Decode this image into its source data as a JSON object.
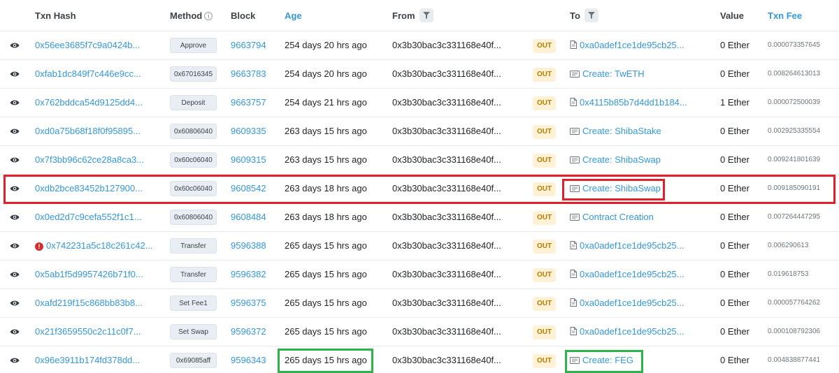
{
  "headers": {
    "txn_hash": "Txn Hash",
    "method": "Method",
    "block": "Block",
    "age": "Age",
    "from": "From",
    "to": "To",
    "value": "Value",
    "txn_fee": "Txn Fee"
  },
  "colors": {
    "link": "#3498db",
    "out_badge_bg": "#fff1d6",
    "out_badge_text": "#b47d00",
    "highlight_red": "#e0212c",
    "highlight_green": "#2db34a"
  },
  "rows": [
    {
      "hash": "0x56ee3685f7c9a0424b...",
      "method": "Approve",
      "block": "9663794",
      "age": "254 days 20 hrs ago",
      "from": "0x3b30bac3c331168e40f...",
      "direction": "OUT",
      "to": "0xa0adef1ce1de95cb25...",
      "to_icon": "file-icon",
      "value": "0 Ether",
      "fee": "0.000073357645",
      "error": false
    },
    {
      "hash": "0xfab1dc849f7c446e9cc...",
      "method": "0x67016345",
      "block": "9663783",
      "age": "254 days 20 hrs ago",
      "from": "0x3b30bac3c331168e40f...",
      "direction": "OUT",
      "to": "Create: TwETH",
      "to_icon": "contract-icon",
      "value": "0 Ether",
      "fee": "0.008264613013",
      "error": false
    },
    {
      "hash": "0x762bddca54d9125dd4...",
      "method": "Deposit",
      "block": "9663757",
      "age": "254 days 21 hrs ago",
      "from": "0x3b30bac3c331168e40f...",
      "direction": "OUT",
      "to": "0x4115b85b7d4dd1b184...",
      "to_icon": "file-icon",
      "value": "1 Ether",
      "fee": "0.000072500039",
      "error": false
    },
    {
      "hash": "0xd0a75b68f18f0f95895...",
      "method": "0x60806040",
      "block": "9609335",
      "age": "263 days 15 hrs ago",
      "from": "0x3b30bac3c331168e40f...",
      "direction": "OUT",
      "to": "Create: ShibaStake",
      "to_icon": "contract-icon",
      "value": "0 Ether",
      "fee": "0.002925335554",
      "error": false
    },
    {
      "hash": "0x7f3bb96c62ce28a8ca3...",
      "method": "0x60c06040",
      "block": "9609315",
      "age": "263 days 15 hrs ago",
      "from": "0x3b30bac3c331168e40f...",
      "direction": "OUT",
      "to": "Create: ShibaSwap",
      "to_icon": "contract-icon",
      "value": "0 Ether",
      "fee": "0.009241801639",
      "error": false
    },
    {
      "hash": "0xdb2bce83452b127900...",
      "method": "0x60c06040",
      "block": "9608542",
      "age": "263 days 18 hrs ago",
      "from": "0x3b30bac3c331168e40f...",
      "direction": "OUT",
      "to": "Create: ShibaSwap",
      "to_icon": "contract-icon",
      "value": "0 Ether",
      "fee": "0.009185090191",
      "error": false
    },
    {
      "hash": "0x0ed2d7c9cefa552f1c1...",
      "method": "0x60806040",
      "block": "9608484",
      "age": "263 days 18 hrs ago",
      "from": "0x3b30bac3c331168e40f...",
      "direction": "OUT",
      "to": "Contract Creation",
      "to_icon": "contract-icon",
      "value": "0 Ether",
      "fee": "0.007264447295",
      "error": false
    },
    {
      "hash": "0x742231a5c18c261c42...",
      "method": "Transfer",
      "block": "9596388",
      "age": "265 days 15 hrs ago",
      "from": "0x3b30bac3c331168e40f...",
      "direction": "OUT",
      "to": "0xa0adef1ce1de95cb25...",
      "to_icon": "file-icon",
      "value": "0 Ether",
      "fee": "0.006290613",
      "error": true
    },
    {
      "hash": "0x5ab1f5d9957426b71f0...",
      "method": "Transfer",
      "block": "9596382",
      "age": "265 days 15 hrs ago",
      "from": "0x3b30bac3c331168e40f...",
      "direction": "OUT",
      "to": "0xa0adef1ce1de95cb25...",
      "to_icon": "file-icon",
      "value": "0 Ether",
      "fee": "0.019618753",
      "error": false
    },
    {
      "hash": "0xafd219f15c868bb83b8...",
      "method": "Set Fee1",
      "block": "9596375",
      "age": "265 days 15 hrs ago",
      "from": "0x3b30bac3c331168e40f...",
      "direction": "OUT",
      "to": "0xa0adef1ce1de95cb25...",
      "to_icon": "file-icon",
      "value": "0 Ether",
      "fee": "0.000057764262",
      "error": false
    },
    {
      "hash": "0x21f3659550c2c11c0f7...",
      "method": "Set Swap",
      "block": "9596372",
      "age": "265 days 15 hrs ago",
      "from": "0x3b30bac3c331168e40f...",
      "direction": "OUT",
      "to": "0xa0adef1ce1de95cb25...",
      "to_icon": "file-icon",
      "value": "0 Ether",
      "fee": "0.000108792306",
      "error": false
    },
    {
      "hash": "0x96e3911b174fd378dd...",
      "method": "0x69085aff",
      "block": "9596343",
      "age": "265 days 15 hrs ago",
      "from": "0x3b30bac3c331168e40f...",
      "direction": "OUT",
      "to": "Create: FEG",
      "to_icon": "contract-icon",
      "value": "0 Ether",
      "fee": "0.004838877441",
      "error": false
    }
  ]
}
